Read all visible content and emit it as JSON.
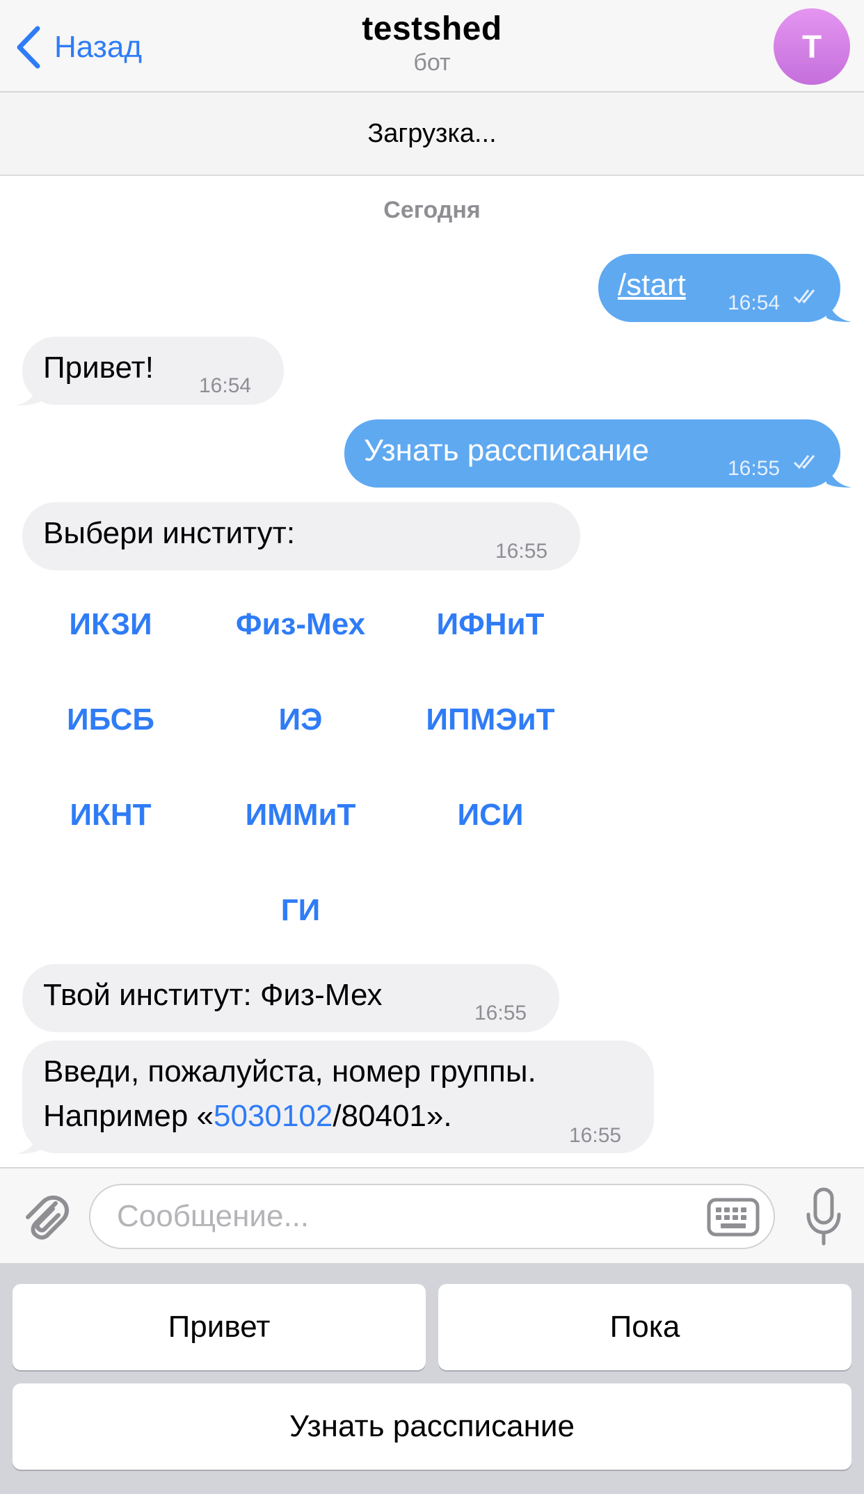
{
  "header": {
    "back_label": "Назад",
    "title": "testshed",
    "subtitle": "бот",
    "avatar_letter": "T",
    "avatar_color": "#d57fe8"
  },
  "status": {
    "loading": "Загрузка..."
  },
  "chat": {
    "date_separator": "Сегодня",
    "messages": [
      {
        "direction": "out",
        "text": "/start",
        "time": "16:54"
      },
      {
        "direction": "in",
        "text": "Привет!",
        "time": "16:54"
      },
      {
        "direction": "out",
        "text": "Узнать рассписание",
        "time": "16:55"
      },
      {
        "direction": "in",
        "text": "Выбери институт:",
        "time": "16:55"
      },
      {
        "direction": "in",
        "text": "Твой институт: Физ-Мех",
        "time": "16:55"
      },
      {
        "direction": "in",
        "line1": "Введи, пожалуйста, номер группы.",
        "line2_prefix": "Например «",
        "line2_link": "5030102",
        "line2_suffix": "/80401».",
        "time": "16:55"
      }
    ],
    "inline_keyboard": [
      [
        "ИКЗИ",
        "Физ-Мех",
        "ИФНиТ"
      ],
      [
        "ИБСБ",
        "ИЭ",
        "ИПМЭиТ"
      ],
      [
        "ИКНТ",
        "ИММиТ",
        "ИСИ"
      ],
      [
        "ГИ"
      ]
    ]
  },
  "input": {
    "placeholder": "Сообщение..."
  },
  "reply_keyboard": {
    "buttons": [
      "Привет",
      "Пока",
      "Узнать рассписание"
    ]
  },
  "colors": {
    "accent": "#2f7cf6",
    "outgoing_bubble": "#5fa9f1",
    "incoming_bubble": "#f0f0f3"
  }
}
